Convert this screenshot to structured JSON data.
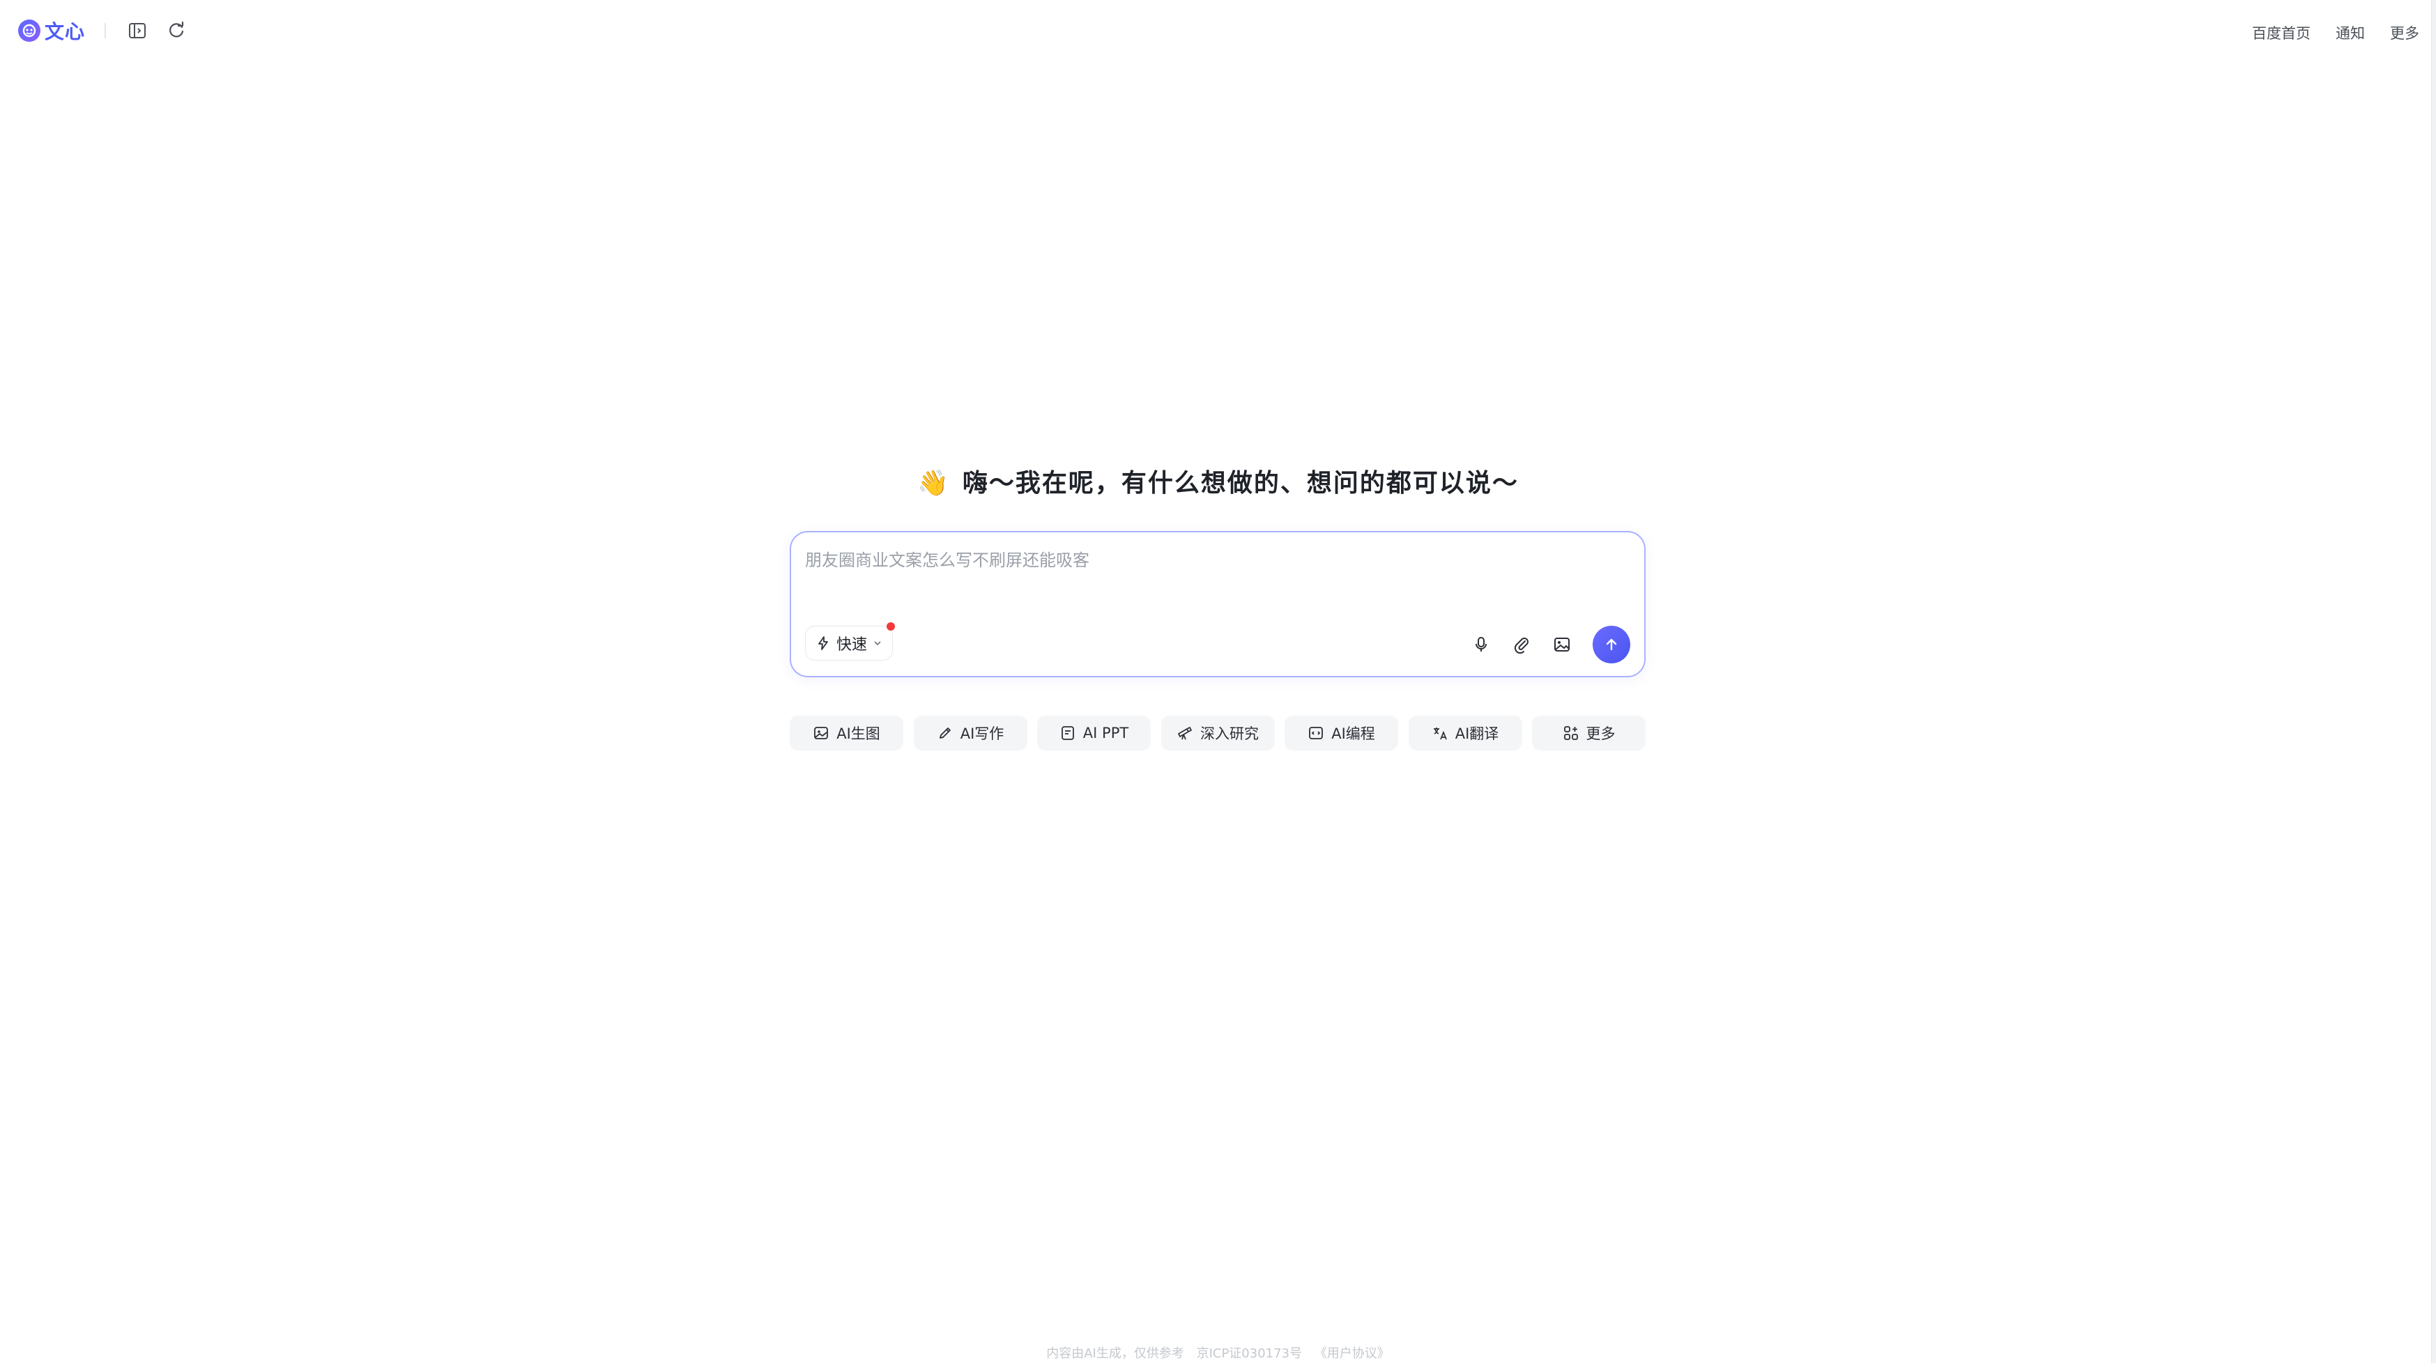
{
  "header": {
    "logo_text": "文心",
    "nav": [
      "百度首页",
      "通知",
      "更多"
    ]
  },
  "greeting": {
    "emoji": "👋",
    "text": "嗨～我在呢，有什么想做的、想问的都可以说～"
  },
  "input": {
    "placeholder": "朋友圈商业文案怎么写不刷屏还能吸客",
    "mode_label": "快速"
  },
  "quick_actions": [
    {
      "label": "AI生图",
      "icon": "image-icon"
    },
    {
      "label": "AI写作",
      "icon": "pen-icon"
    },
    {
      "label": "AI PPT",
      "icon": "ppt-icon"
    },
    {
      "label": "深入研究",
      "icon": "telescope-icon"
    },
    {
      "label": "AI编程",
      "icon": "code-icon"
    },
    {
      "label": "AI翻译",
      "icon": "translate-icon"
    },
    {
      "label": "更多",
      "icon": "grid-icon"
    }
  ],
  "footer": {
    "disclaimer": "内容由AI生成，仅供参考",
    "icp": "京ICP证030173号",
    "agreement": "《用户协议》"
  },
  "colors": {
    "accent": "#4e5bf5",
    "input_border": "#a9b2ff",
    "chip_bg": "#f4f5f7",
    "notify_dot": "#f43b3b"
  }
}
